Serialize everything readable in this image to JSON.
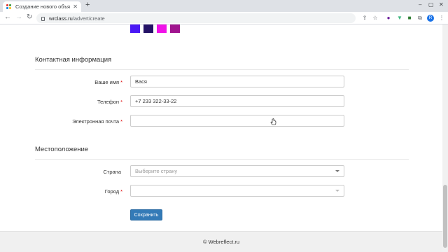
{
  "browser": {
    "tab_title": "Создание нового объяв",
    "url_domain": "wrclass.ru",
    "url_path": "/advert/create",
    "profile_initial": "R",
    "icons": [
      "back-arrow-icon",
      "forward-arrow-icon",
      "reload-icon",
      "lock-icon",
      "share-icon",
      "star-icon",
      "extension-icon",
      "puzzle-icon",
      "menu-icon"
    ]
  },
  "swatches": [
    "#4a18f5",
    "#241266",
    "#f012e8",
    "#a0148e"
  ],
  "contact": {
    "title": "Контактная информация",
    "name_label": "Ваше имя",
    "name_value": "Вася",
    "phone_label": "Телефон",
    "phone_value": "+7 233 322-33-22",
    "email_label": "Электронная почта",
    "email_value": ""
  },
  "location": {
    "title": "Местоположение",
    "country_label": "Страна",
    "country_placeholder": "Выберите страну",
    "city_label": "Город",
    "city_value": ""
  },
  "required_mark": "*",
  "save_label": "Сохранить",
  "footer_text": "© Webreflect.ru",
  "colors": {
    "primary": "#337ab7",
    "required": "#dd0000"
  }
}
